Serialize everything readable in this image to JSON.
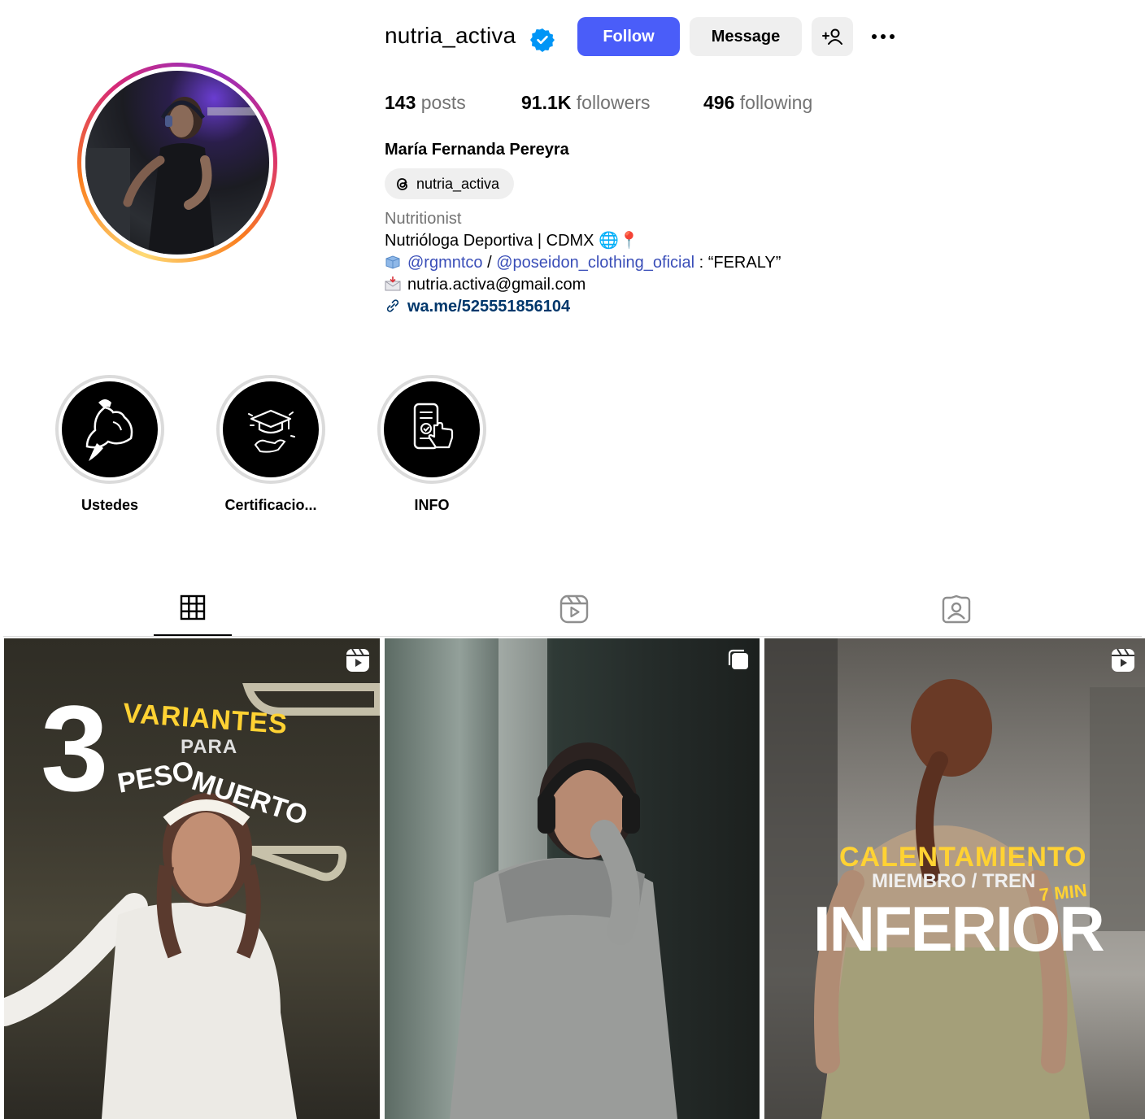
{
  "profile": {
    "username": "nutria_activa",
    "verified_icon": "verified-badge-icon",
    "full_name": "María Fernanda Pereyra",
    "threads_handle": "nutria_activa",
    "category": "Nutritionist",
    "bio_line1": "Nutrióloga Deportiva | CDMX 🌐📍",
    "bio_mention1": "@rgmntco",
    "bio_sep": " / ",
    "bio_mention2": "@poseidon_clothing_oficial",
    "bio_code": " : “FERALY”",
    "bio_email": "nutria.activa@gmail.com",
    "bio_link": "wa.me/525551856104"
  },
  "actions": {
    "follow_label": "Follow",
    "message_label": "Message"
  },
  "stats": {
    "posts_count": "143",
    "posts_label": "posts",
    "followers_count": "91.1K",
    "followers_label": "followers",
    "following_count": "496",
    "following_label": "following"
  },
  "highlights": [
    {
      "label": "Ustedes",
      "icon": "flexed-bicep-icon"
    },
    {
      "label": "Certificacio...",
      "icon": "graduation-cap-icon"
    },
    {
      "label": "INFO",
      "icon": "phone-tap-icon"
    }
  ],
  "tabs": [
    {
      "icon": "grid-icon",
      "active": true
    },
    {
      "icon": "reels-icon",
      "active": false
    },
    {
      "icon": "tagged-icon",
      "active": false
    }
  ],
  "posts": [
    {
      "type": "reel",
      "text": {
        "number": "3",
        "line1": "VARIANTES",
        "line2": "PARA",
        "line3a": "PESO",
        "line3b": "MUERTO"
      }
    },
    {
      "type": "carousel"
    },
    {
      "type": "reel",
      "text": {
        "line1": "CALENTAMIENTO",
        "line2": "MIEMBRO / TREN",
        "line3": "7 MIN",
        "line4": "INFERIOR"
      }
    }
  ],
  "colors": {
    "follow_button": "#4a5df9",
    "mention": "#3a4eb8",
    "link": "#00376b",
    "muted": "#737373",
    "button_gray": "#efefef",
    "verified": "#0095f6",
    "overlay_yellow": "#ffd233"
  }
}
